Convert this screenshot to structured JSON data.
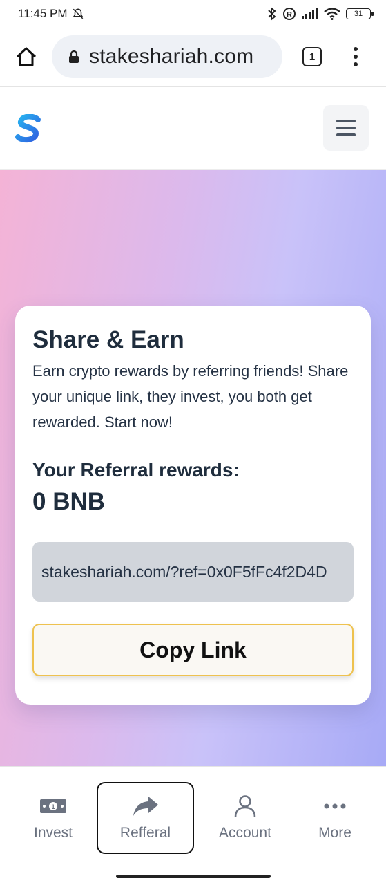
{
  "status_bar": {
    "time": "11:45 PM",
    "battery": "31"
  },
  "browser": {
    "url": "stakeshariah.com",
    "tab_count": "1"
  },
  "card": {
    "title": "Share & Earn",
    "description": "Earn crypto rewards by referring friends! Share your unique link, they invest, you both get rewarded. Start now!",
    "rewards_label": "Your Referral rewards:",
    "rewards_value": "0 BNB",
    "referral_link": "stakeshariah.com/?ref=0x0F5fFc4f2D4D",
    "copy_button": "Copy Link"
  },
  "bottom_nav": {
    "items": [
      {
        "label": "Invest",
        "icon": "money-icon"
      },
      {
        "label": "Refferal",
        "icon": "share-icon"
      },
      {
        "label": "Account",
        "icon": "user-icon"
      },
      {
        "label": "More",
        "icon": "dots-icon"
      }
    ]
  },
  "colors": {
    "accent_border": "#eec24f",
    "gradient_start": "#f4b3d6",
    "gradient_end": "#a7aaf6",
    "text_dark": "#1f2d3d"
  }
}
